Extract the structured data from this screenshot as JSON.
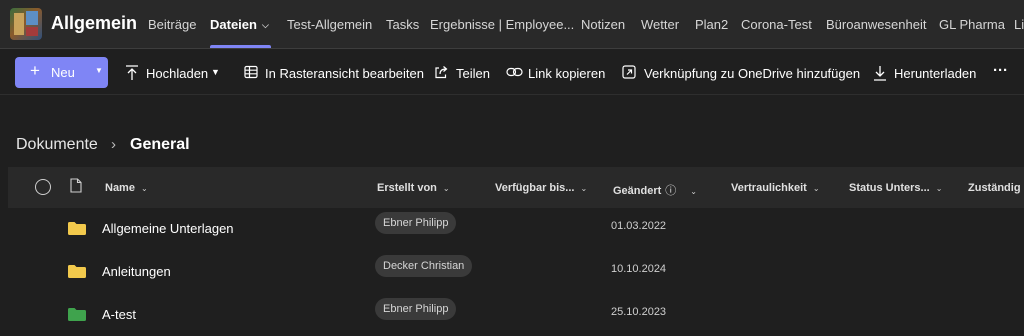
{
  "team": {
    "name": "Allgemein"
  },
  "tabs": [
    {
      "label": "Beiträge"
    },
    {
      "label": "Dateien"
    },
    {
      "label": "Test-Allgemein"
    },
    {
      "label": "Tasks"
    },
    {
      "label": "Ergebnisse | Employee..."
    },
    {
      "label": "Notizen"
    },
    {
      "label": "Wetter"
    },
    {
      "label": "Plan2"
    },
    {
      "label": "Corona-Test"
    },
    {
      "label": "Büroanwesenheit"
    },
    {
      "label": "GL Pharma"
    },
    {
      "label": "Li"
    }
  ],
  "active_tab": "Dateien",
  "toolbar": {
    "new_label": "Neu",
    "upload_label": "Hochladen",
    "grid_edit_label": "In Rasteransicht bearbeiten",
    "share_label": "Teilen",
    "copy_link_label": "Link kopieren",
    "onedrive_label": "Verknüpfung zu OneDrive hinzufügen",
    "download_label": "Herunterladen",
    "more_label": "···"
  },
  "breadcrumb": {
    "root": "Dokumente",
    "separator": "›",
    "current": "General"
  },
  "columns": {
    "name": "Name",
    "created_by": "Erstellt von",
    "available_until": "Verfügbar bis...",
    "modified": "Geändert",
    "confidentiality": "Vertraulichkeit",
    "status": "Status Unters...",
    "responsible": "Zuständig"
  },
  "rows": [
    {
      "name": "Allgemeine Unterlagen",
      "created_by": "Ebner Philipp",
      "modified": "01.03.2022",
      "folder_color": "#f2c94c"
    },
    {
      "name": "Anleitungen",
      "created_by": "Decker Christian",
      "modified": "10.10.2024",
      "folder_color": "#f2c94c"
    },
    {
      "name": "A-test",
      "created_by": "Ebner Philipp",
      "modified": "25.10.2023",
      "folder_color": "#3fa34d"
    }
  ],
  "colors": {
    "accent": "#7f85f5",
    "background": "#1f1f1f",
    "topbar": "#292929"
  }
}
